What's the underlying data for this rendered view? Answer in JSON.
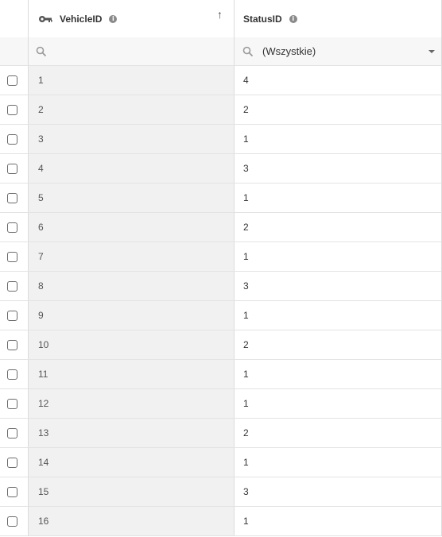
{
  "columns": [
    {
      "header": "VehicleID",
      "sort_indicator": "↑",
      "icon": "key-icon",
      "info_icon": "i"
    },
    {
      "header": "StatusID",
      "info_icon": "i"
    }
  ],
  "filters": {
    "col_a_search_value": "",
    "col_b_selected": "(Wszystkie)"
  },
  "rows": [
    {
      "vehicle_id": "1",
      "status_id": "4"
    },
    {
      "vehicle_id": "2",
      "status_id": "2"
    },
    {
      "vehicle_id": "3",
      "status_id": "1"
    },
    {
      "vehicle_id": "4",
      "status_id": "3"
    },
    {
      "vehicle_id": "5",
      "status_id": "1"
    },
    {
      "vehicle_id": "6",
      "status_id": "2"
    },
    {
      "vehicle_id": "7",
      "status_id": "1"
    },
    {
      "vehicle_id": "8",
      "status_id": "3"
    },
    {
      "vehicle_id": "9",
      "status_id": "1"
    },
    {
      "vehicle_id": "10",
      "status_id": "2"
    },
    {
      "vehicle_id": "11",
      "status_id": "1"
    },
    {
      "vehicle_id": "12",
      "status_id": "1"
    },
    {
      "vehicle_id": "13",
      "status_id": "2"
    },
    {
      "vehicle_id": "14",
      "status_id": "1"
    },
    {
      "vehicle_id": "15",
      "status_id": "3"
    },
    {
      "vehicle_id": "16",
      "status_id": "1"
    }
  ]
}
